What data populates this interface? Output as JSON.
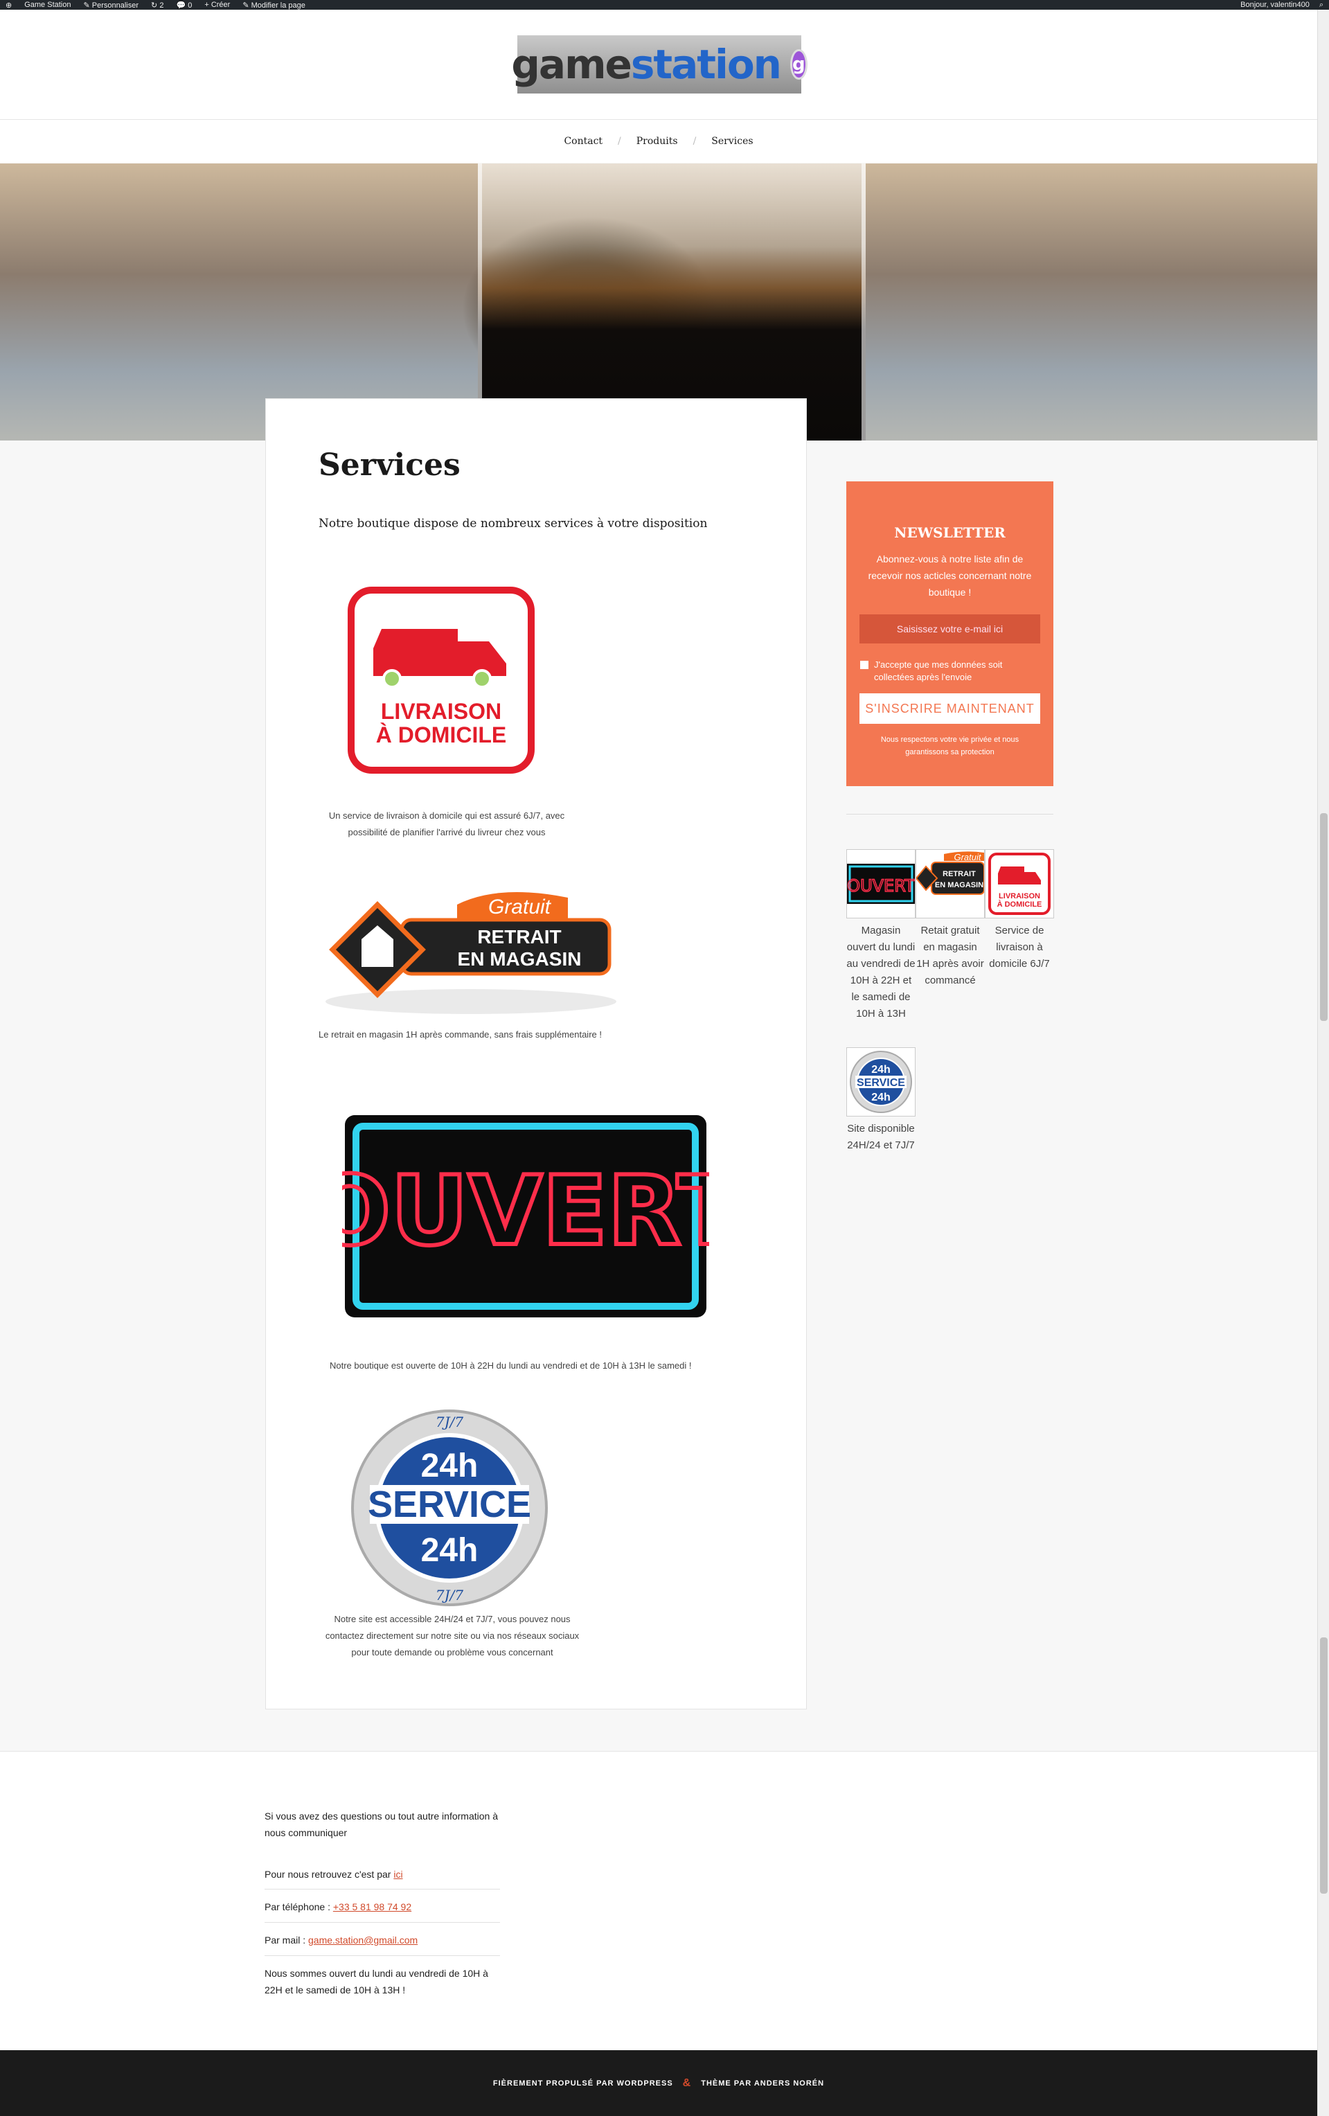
{
  "adminbar": {
    "site": "Game Station",
    "customize": "Personnaliser",
    "updates": "2",
    "comments": "0",
    "new": "Créer",
    "edit": "Modifier la page",
    "greeting": "Bonjour, valentin400"
  },
  "header": {
    "logo_text_a": "game",
    "logo_text_b": "station",
    "logo_badge": "g"
  },
  "nav": {
    "items": [
      "Contact",
      "Produits",
      "Services"
    ]
  },
  "page": {
    "title": "Services",
    "intro": "Notre boutique dispose de nombreux services à votre disposition",
    "livraison_caption": "Un service de livraison à domicile qui est assuré 6J/7, avec possibilité de planifier l'arrivé du livreur chez vous",
    "retrait_caption": "Le retrait en magasin 1H après commande, sans frais supplémentaire !",
    "ouvert_caption": "Notre boutique est ouverte de 10H à 22H du lundi au vendredi et de 10H à 13H le samedi !",
    "service_caption": "Notre site est accessible 24H/24 et 7J/7, vous pouvez nous contactez directement sur notre site ou via nos réseaux sociaux pour toute demande ou problème vous concernant"
  },
  "badges": {
    "livraison_l1": "LIVRAISON",
    "livraison_l2": "À DOMICILE",
    "retrait_free": "Gratuit",
    "retrait_l1": "RETRAIT",
    "retrait_l2": "EN MAGASIN",
    "ouvert": "OUVERT",
    "svc_top": "7J/7",
    "svc_24a": "24h",
    "svc_word": "SERVICE",
    "svc_24b": "24h",
    "svc_bottom": "7J/7"
  },
  "newsletter": {
    "title": "NEWSLETTER",
    "description": "Abonnez-vous à notre liste afin de recevoir nos acticles concernant notre boutique !",
    "email_placeholder": "Saisissez votre e-mail ici",
    "consent": "J'accepte que mes données soit collectées après l'envoie",
    "button": "S'INSCRIRE MAINTENANT",
    "note": "Nous respectons votre vie privée et nous garantissons sa protection"
  },
  "gallery": [
    {
      "caption": "Magasin ouvert du lundi au vendredi de 10H à 22H et le samedi de 10H à 13H"
    },
    {
      "caption": "Retait gratuit en magasin 1H après avoir commancé"
    },
    {
      "caption": "Service de livraison à domicile 6J/7"
    },
    {
      "caption": "Site disponible 24H/24 et 7J/7"
    }
  ],
  "footer": {
    "questions": "Si vous avez des questions ou tout autre information à nous communiquer",
    "find_prefix": "Pour nous retrouvez c'est par ",
    "find_link": "ici",
    "phone_prefix": "Par téléphone : ",
    "phone": "+33 5 81 98 74 92",
    "mail_prefix": "Par mail : ",
    "mail": "game.station@gmail.com",
    "hours": "Nous sommes ouvert du lundi au vendredi de 10H à 22H et le samedi de 10H à 13H !"
  },
  "credits": {
    "left": "FIÈREMENT PROPULSÉ PAR WORDPRESS",
    "amp": "&",
    "right": "THÈME PAR ANDERS NORÉN"
  },
  "colors": {
    "accent": "#f37752",
    "link": "#d14a2b",
    "dark": "#1b1b1b"
  }
}
